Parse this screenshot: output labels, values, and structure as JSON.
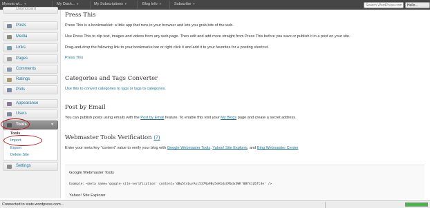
{
  "admin_bar": {
    "site_name": "Mynote.wl...",
    "my_dashboard": "My Dash...",
    "my_subscriptions": "My Subscriptions",
    "blog_info": "Blog Info",
    "subscribe": "Subscribe",
    "search_placeholder": "Search WordPress.com",
    "user_button": "Hello..."
  },
  "sidebar": {
    "top_partial": "Dashboard",
    "items": [
      {
        "label": "Posts",
        "icon": "pushpin-icon",
        "color": "#7a8a9a"
      },
      {
        "label": "Media",
        "icon": "media-icon",
        "color": "#8a8a7a"
      },
      {
        "label": "Links",
        "icon": "link-icon",
        "color": "#7a9aaa"
      },
      {
        "label": "Pages",
        "icon": "page-icon",
        "color": "#9a9a9a"
      },
      {
        "label": "Comments",
        "icon": "comment-icon",
        "color": "#8a9aaa"
      },
      {
        "label": "Ratings",
        "icon": "star-icon",
        "color": "#aa9a6a"
      },
      {
        "label": "Polls",
        "icon": "poll-icon",
        "color": "#7a8aaa"
      },
      {
        "label": "Appearance",
        "icon": "brush-icon",
        "color": "#8a7a9a"
      },
      {
        "label": "Users",
        "icon": "users-icon",
        "color": "#7a8a9a"
      },
      {
        "label": "Tools",
        "icon": "tools-icon",
        "color": "#555555"
      },
      {
        "label": "Settings",
        "icon": "settings-icon",
        "color": "#8a8a8a"
      }
    ],
    "tools_submenu": [
      "Tools",
      "Import",
      "Export",
      "Delete Site"
    ]
  },
  "sections": {
    "press_this": {
      "title": "Press This",
      "line1": "Press This is a bookmarklet: a little app that runs in your browser and lets you grab bits of the web.",
      "line2": "Use Press This to clip text, images and videos from any web page. Then edit and add more straight from Press This before you save or publish it in a post on your site.",
      "line3": "Drag-and-drop the following link to your bookmarks bar or right click it and add it to your favorites for a posting shortcut.",
      "link": "Press This"
    },
    "converter": {
      "title": "Categories and Tags Converter",
      "text_link": "Use this to convert categories to tags or tags to categories."
    },
    "post_by_email": {
      "title": "Post by Email",
      "text_pre": "You can publish posts using emails with the",
      "text_link": "Post by Email",
      "text_mid": "feature. To enable this visit your",
      "text_link2": "My Blogs",
      "text_post": "page and create a secret address."
    },
    "webmaster": {
      "title": "Webmaster Tools Verification",
      "help": "(?)",
      "text_pre": "Enter your meta key \"content\" value to verify your blog with",
      "link_google": "Google Webmaster Tools",
      "link_yahoo": "Yahoo! Site Explorer",
      "text_and": ", and",
      "link_bing": "Bing Webmaster Center",
      "google_label": "Google Webmaster Tools",
      "example": "Example: <meta name='google-site-verification' content='dBw5CvburAxi537Rp9Bu5eH1dxCMbdx5WR'0BY41Z6ft4e' />",
      "yahoo_label": "Yahoo! Site Explorer"
    }
  },
  "status_bar": {
    "text": "Connected to stats.wordpress.com...",
    "progress": 1.0
  }
}
